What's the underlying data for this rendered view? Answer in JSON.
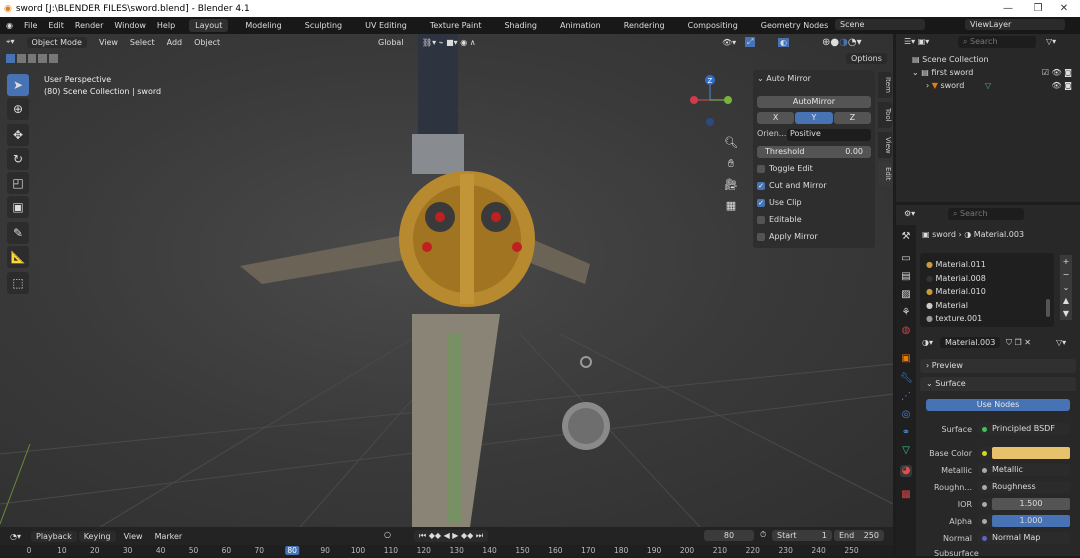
{
  "titlebar": {
    "title": "sword [J:\\BLENDER FILES\\sword.blend] - Blender 4.1",
    "minimize": "—",
    "maximize": "❐",
    "close": "✕"
  },
  "menu": {
    "items": [
      "File",
      "Edit",
      "Render",
      "Window",
      "Help"
    ],
    "workspaces": [
      "Layout",
      "Modeling",
      "Sculpting",
      "UV Editing",
      "Texture Paint",
      "Shading",
      "Animation",
      "Rendering",
      "Compositing",
      "Geometry Nodes",
      "Scripting"
    ],
    "add_workspace": "+",
    "scene": "Scene",
    "view_layer": "ViewLayer"
  },
  "viewport": {
    "mode": "Object Mode",
    "menus": [
      "View",
      "Select",
      "Add",
      "Object"
    ],
    "orientation": "Global",
    "options": "Options",
    "overlay_title": "User Perspective",
    "overlay_sub": "(80) Scene Collection | sword",
    "tools": [
      "select-box",
      "cursor",
      "move",
      "rotate",
      "scale",
      "transform",
      "annotate",
      "measure",
      "add-cube"
    ],
    "gizmo": {
      "x": "X",
      "y": "Y",
      "z": "Z"
    }
  },
  "npanel": {
    "title": "Auto Mirror",
    "automirror": "AutoMirror",
    "axes": [
      "X",
      "Y",
      "Z"
    ],
    "active_axis": "Y",
    "orientation_label": "Orien...",
    "orientation": "Positive",
    "threshold_label": "Threshold",
    "threshold": "0.00",
    "checks": [
      {
        "label": "Toggle Edit",
        "on": false
      },
      {
        "label": "Cut and Mirror",
        "on": true
      },
      {
        "label": "Use Clip",
        "on": true
      },
      {
        "label": "Editable",
        "on": false
      },
      {
        "label": "Apply Mirror",
        "on": false
      }
    ],
    "tabs": [
      "Item",
      "Tool",
      "View",
      "Edit"
    ]
  },
  "outliner": {
    "search_placeholder": "Search",
    "scene_collection": "Scene Collection",
    "collection": "first sword",
    "object": "sword"
  },
  "properties": {
    "search_placeholder": "Search",
    "breadcrumb_object": "sword",
    "breadcrumb_material": "Material.003",
    "materials": [
      "Material.011",
      "Material.008",
      "Material.010",
      "Material",
      "texture.001"
    ],
    "material_name": "Material.003",
    "preview": "Preview",
    "surface_panel": "Surface",
    "use_nodes": "Use Nodes",
    "rows": [
      {
        "label": "Surface",
        "value": "Principled BSDF",
        "dot": "#3fc35a"
      },
      {
        "label": "Base Color",
        "value": "",
        "dot": "#d6d61a",
        "color": "#e8c26a"
      },
      {
        "label": "Metallic",
        "value": "Metallic",
        "dot": "#a0a0a0"
      },
      {
        "label": "Roughn...",
        "value": "Roughness",
        "dot": "#a0a0a0"
      },
      {
        "label": "IOR",
        "value": "1.500",
        "dot": "#a0a0a0"
      },
      {
        "label": "Alpha",
        "value": "1.000",
        "dot": "#a0a0a0"
      },
      {
        "label": "Normal",
        "value": "Normal Map",
        "dot": "#6363c7"
      }
    ],
    "subsurface": "Subsurface"
  },
  "timeline": {
    "menus": [
      "Playback",
      "Keying",
      "View",
      "Marker"
    ],
    "current_frame": "80",
    "start_label": "Start",
    "start": "1",
    "end_label": "End",
    "end": "250",
    "ticks": [
      "0",
      "10",
      "20",
      "30",
      "40",
      "50",
      "60",
      "70",
      "80",
      "90",
      "100",
      "110",
      "120",
      "130",
      "140",
      "150",
      "160",
      "170",
      "180",
      "190",
      "200",
      "210",
      "220",
      "230",
      "240",
      "250"
    ]
  },
  "colors": {
    "accent": "#4772b3",
    "bg": "#1d1d1d"
  }
}
